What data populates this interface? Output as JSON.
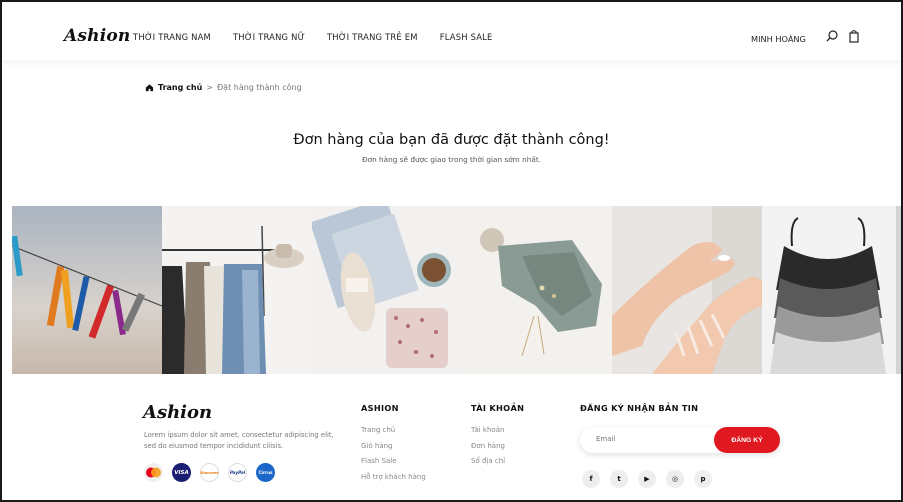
{
  "header": {
    "logo": "Ashion",
    "nav": [
      "THỜI TRANG NAM",
      "THỜI TRANG NỮ",
      "THỜI TRANG TRẺ EM",
      "FLASH SALE"
    ],
    "user": "MINH HOÀNG",
    "icons": [
      "search-icon",
      "bag-icon"
    ]
  },
  "breadcrumb": {
    "home": "Trang chủ",
    "separator": ">",
    "current": "Đặt hàng thành công"
  },
  "message": {
    "title": "Đơn hàng của bạn đã được đặt thành công!",
    "subtitle": "Đơn hàng sẽ được giao trong thời gian sớm nhất."
  },
  "gallery": [
    "clothespins",
    "clothes-rack",
    "yarn-and-coffee",
    "knitted-bonnet",
    "hands-cream",
    "tank-tops"
  ],
  "footer": {
    "logo": "Ashion",
    "description": "Lorem ipsum dolor sit amet, consectetur adipiscing elit, sed do eiusmod tempor incididunt cilisis.",
    "payments": [
      "Mastercard",
      "VISA",
      "Discover",
      "PayPal",
      "Cirrus"
    ],
    "columns": [
      {
        "title": "ASHION",
        "links": [
          "Trang chủ",
          "Giỏ hàng",
          "Flash Sale",
          "Hỗ trợ khách hàng"
        ]
      },
      {
        "title": "TÀI KHOẢN",
        "links": [
          "Tài khoản",
          "Đơn hàng",
          "Sổ địa chỉ"
        ]
      }
    ],
    "newsletter": {
      "title": "ĐĂNG KÝ NHẬN BẢN TIN",
      "placeholder": "Email",
      "button": "ĐĂNG KÝ"
    },
    "socials": [
      "f",
      "t",
      "▶",
      "◎",
      "p"
    ]
  },
  "colors": {
    "accent": "#e0181f",
    "text": "#111111",
    "muted": "#888888"
  }
}
